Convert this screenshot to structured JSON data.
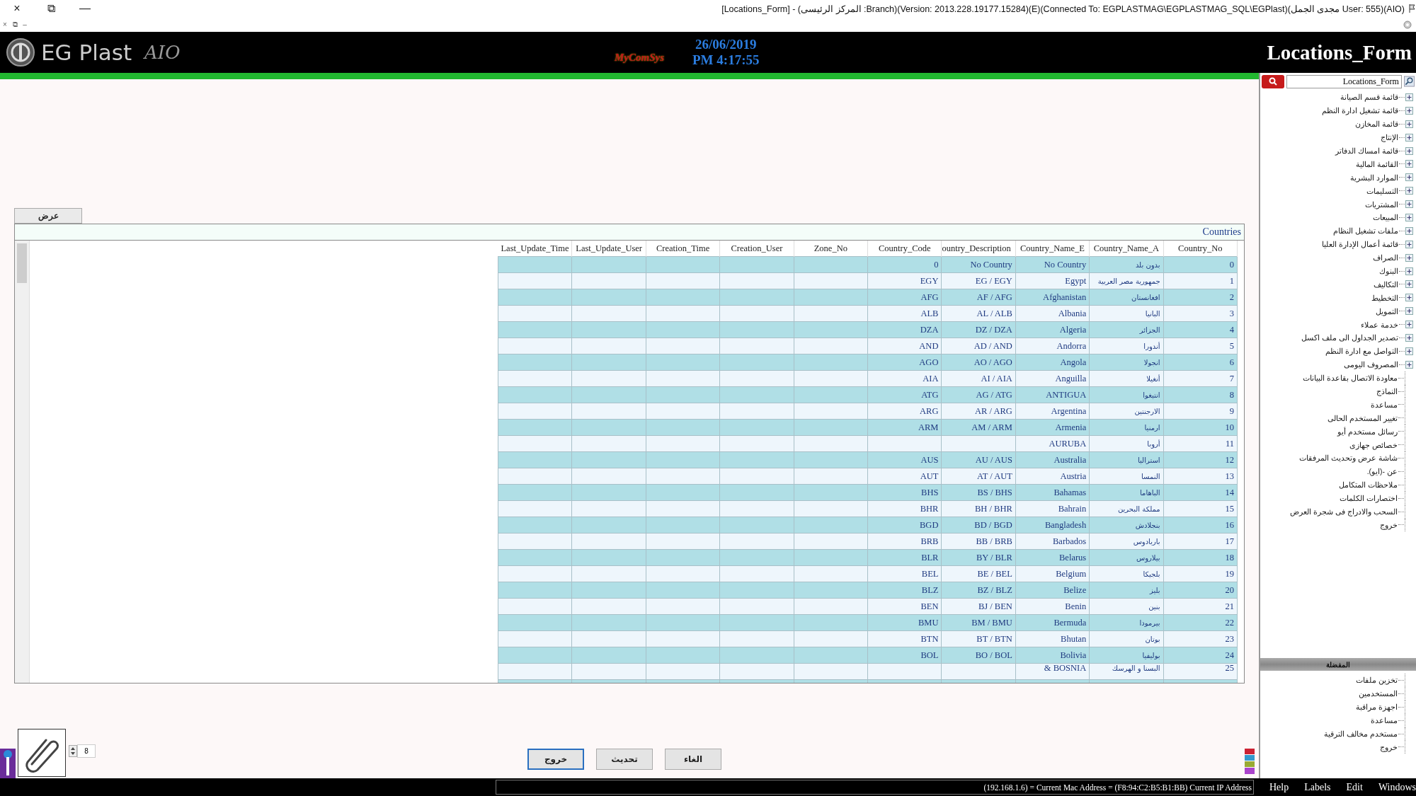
{
  "window": {
    "controls": [
      "—",
      "⧉",
      "×"
    ],
    "mdi_controls": [
      "–",
      "⧉",
      "×"
    ],
    "title": "[Locations_Form] - (المركز الرئيسى :Branch)(Version: 2013.228.19177.15284)(E)(Connected To: EGPLASTMAG\\EGPLASTMAG_SQL\\EGPlast)(مجدى الجمل User: 555)(AIO)"
  },
  "header": {
    "app_name": "EG Plast",
    "edition": "AIO",
    "vendor": "MyComSys",
    "date": "26/06/2019",
    "time": "PM 4:17:55",
    "form_title": "Locations_Form"
  },
  "view_tab": {
    "label": "عرض"
  },
  "grid": {
    "title": "Countries",
    "columns": [
      "Country_No",
      "Country_Name_A",
      "Country_Name_E",
      "ountry_Description",
      "Country_Code",
      "Zone_No",
      "Creation_User",
      "Creation_Time",
      "Last_Update_User",
      "Last_Update_Time"
    ],
    "rows": [
      {
        "country_code": "0",
        "country_description": "No Country",
        "country_name_e": "No Country",
        "country_name_a": "بدون بلد",
        "country_no": "0"
      },
      {
        "country_code": "EGY",
        "country_description": "EG / EGY",
        "country_name_e": "Egypt",
        "country_name_a": "جمهورية مصر العربية",
        "country_no": "1"
      },
      {
        "country_code": "AFG",
        "country_description": "AF / AFG",
        "country_name_e": "Afghanistan",
        "country_name_a": "افغانستان",
        "country_no": "2"
      },
      {
        "country_code": "ALB",
        "country_description": "AL / ALB",
        "country_name_e": "Albania",
        "country_name_a": "البانيا",
        "country_no": "3"
      },
      {
        "country_code": "DZA",
        "country_description": "DZ / DZA",
        "country_name_e": "Algeria",
        "country_name_a": "الجزائر",
        "country_no": "4"
      },
      {
        "country_code": "AND",
        "country_description": "AD / AND",
        "country_name_e": "Andorra",
        "country_name_a": "أندورا",
        "country_no": "5"
      },
      {
        "country_code": "AGO",
        "country_description": "AO / AGO",
        "country_name_e": "Angola",
        "country_name_a": "انجولا",
        "country_no": "6"
      },
      {
        "country_code": "AIA",
        "country_description": "AI / AIA",
        "country_name_e": "Anguilla",
        "country_name_a": "أنغيلا",
        "country_no": "7"
      },
      {
        "country_code": "ATG",
        "country_description": "AG / ATG",
        "country_name_e": "ANTIGUA",
        "country_name_a": "انتيغوا",
        "country_no": "8"
      },
      {
        "country_code": "ARG",
        "country_description": "AR / ARG",
        "country_name_e": "Argentina",
        "country_name_a": "الارجنتين",
        "country_no": "9"
      },
      {
        "country_code": "ARM",
        "country_description": "AM / ARM",
        "country_name_e": "Armenia",
        "country_name_a": "ارمنيا",
        "country_no": "10"
      },
      {
        "country_name_e": "AURUBA",
        "country_name_a": "أروبا",
        "country_no": "11"
      },
      {
        "country_code": "AUS",
        "country_description": "AU / AUS",
        "country_name_e": "Australia",
        "country_name_a": "استراليا",
        "country_no": "12"
      },
      {
        "country_code": "AUT",
        "country_description": "AT / AUT",
        "country_name_e": "Austria",
        "country_name_a": "النمسا",
        "country_no": "13"
      },
      {
        "country_code": "BHS",
        "country_description": "BS / BHS",
        "country_name_e": "Bahamas",
        "country_name_a": "الباهاما",
        "country_no": "14"
      },
      {
        "country_code": "BHR",
        "country_description": "BH / BHR",
        "country_name_e": "Bahrain",
        "country_name_a": "مملكة البحرين",
        "country_no": "15"
      },
      {
        "country_code": "BGD",
        "country_description": "BD / BGD",
        "country_name_e": "Bangladesh",
        "country_name_a": "بنجلادش",
        "country_no": "16"
      },
      {
        "country_code": "BRB",
        "country_description": "BB / BRB",
        "country_name_e": "Barbados",
        "country_name_a": "باربادوس",
        "country_no": "17"
      },
      {
        "country_code": "BLR",
        "country_description": "BY / BLR",
        "country_name_e": "Belarus",
        "country_name_a": "بيلاروس",
        "country_no": "18"
      },
      {
        "country_code": "BEL",
        "country_description": "BE / BEL",
        "country_name_e": "Belgium",
        "country_name_a": "بلجيكا",
        "country_no": "19"
      },
      {
        "country_code": "BLZ",
        "country_description": "BZ / BLZ",
        "country_name_e": "Belize",
        "country_name_a": "بليز",
        "country_no": "20"
      },
      {
        "country_code": "BEN",
        "country_description": "BJ / BEN",
        "country_name_e": "Benin",
        "country_name_a": "بنين",
        "country_no": "21"
      },
      {
        "country_code": "BMU",
        "country_description": "BM / BMU",
        "country_name_e": "Bermuda",
        "country_name_a": "بيرمودا",
        "country_no": "22"
      },
      {
        "country_code": "BTN",
        "country_description": "BT / BTN",
        "country_name_e": "Bhutan",
        "country_name_a": "بوتان",
        "country_no": "23"
      },
      {
        "country_code": "BOL",
        "country_description": "BO / BOL",
        "country_name_e": "Bolivia",
        "country_name_a": "بوليفيا",
        "country_no": "24"
      },
      {
        "country_name_e": "& BOSNIA",
        "country_name_a": "البسنا و الهرسك",
        "country_no": "25"
      }
    ]
  },
  "attachments": {
    "count": "8"
  },
  "buttons": [
    {
      "label": "الغاء",
      "focused": false
    },
    {
      "label": "تحديث",
      "focused": false
    },
    {
      "label": "خروج",
      "focused": true
    }
  ],
  "sidebar": {
    "search": {
      "value": "Locations_Form"
    },
    "tree": [
      {
        "label": "قائمة قسم الصيانة",
        "kind": "group"
      },
      {
        "label": "قائمة تشغيل ادارة النظم",
        "kind": "group"
      },
      {
        "label": "قائمة المخازن",
        "kind": "group"
      },
      {
        "label": "الإنتاج",
        "kind": "group"
      },
      {
        "label": "قائمة امساك الدفاتر",
        "kind": "group"
      },
      {
        "label": "القائمة المالية",
        "kind": "group"
      },
      {
        "label": "الموارد البشرية",
        "kind": "group"
      },
      {
        "label": "التسليمات",
        "kind": "group"
      },
      {
        "label": "المشتريات",
        "kind": "group"
      },
      {
        "label": "المبيعات",
        "kind": "group"
      },
      {
        "label": "ملفات تشغيل النظام",
        "kind": "group"
      },
      {
        "label": "قائمة أعمال الإدارة العليا",
        "kind": "group"
      },
      {
        "label": "الصراف",
        "kind": "group"
      },
      {
        "label": "البنوك",
        "kind": "group"
      },
      {
        "label": "التكاليف",
        "kind": "group"
      },
      {
        "label": "التخطيط",
        "kind": "group"
      },
      {
        "label": "التمويل",
        "kind": "group"
      },
      {
        "label": "خدمة عملاء",
        "kind": "group"
      },
      {
        "label": "تصدير الجداول الى ملف اكسل",
        "kind": "group"
      },
      {
        "label": "التواصل مع ادارة النظم",
        "kind": "group"
      },
      {
        "label": "المصروف اليومى",
        "kind": "group"
      },
      {
        "label": "معاودة الاتصال بقاعدة البيانات",
        "kind": "leaf"
      },
      {
        "label": "النماذج",
        "kind": "leaf"
      },
      {
        "label": "مساعدة",
        "kind": "leaf"
      },
      {
        "label": "تغيير المستخدم الحالى",
        "kind": "leaf"
      },
      {
        "label": "رسائل مستخدم أيو",
        "kind": "leaf"
      },
      {
        "label": "خصائص جهازى",
        "kind": "leaf"
      },
      {
        "label": "شاشة عرض وتحديث المرفقات",
        "kind": "leaf"
      },
      {
        "label": "عن -(ايو).",
        "kind": "leaf"
      },
      {
        "label": "ملاحظات المتكامل",
        "kind": "leaf"
      },
      {
        "label": "اختصارات الكلمات",
        "kind": "leaf"
      },
      {
        "label": "السحب والادراج فى شجرة العرض",
        "kind": "leaf"
      },
      {
        "label": "خروج",
        "kind": "leaf"
      }
    ],
    "favorites_title": "المفضلة",
    "favorites": [
      "تخزين ملفات",
      "المستخدمين",
      "اجهزة مراقبة",
      "مساعدة",
      "مستخدم مخالف الترقية",
      "خروج"
    ]
  },
  "status_bar": {
    "info": "(192.168.1.6) = Current Mac Address = (F8:94:C2:B5:B1:BB) Current IP Address",
    "menu": [
      "Windows",
      "Edit",
      "Labels",
      "Help"
    ]
  }
}
